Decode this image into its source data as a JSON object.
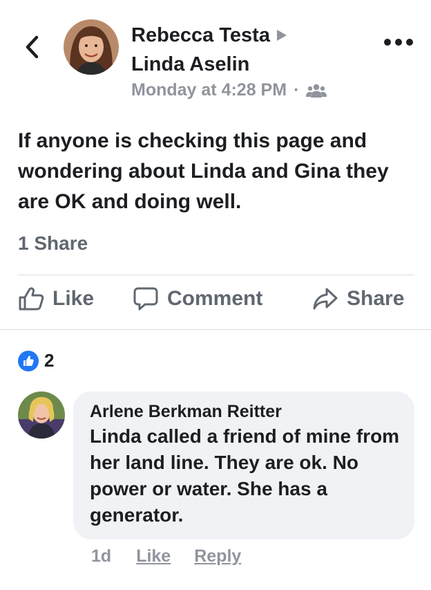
{
  "header": {
    "author": "Rebecca Testa",
    "target": "Linda Aselin",
    "timestamp": "Monday at 4:28 PM",
    "separator": "·",
    "privacy_icon": "group-icon"
  },
  "post": {
    "text": "If anyone is checking this page and wondering about Linda and Gina they are OK and doing well.",
    "share_count": "1 Share"
  },
  "actions": {
    "like": "Like",
    "comment": "Comment",
    "share": "Share"
  },
  "reactions": {
    "count": "2"
  },
  "comment": {
    "author": "Arlene Berkman Reitter",
    "text": "Linda called a friend of mine from her land line. They are ok. No power or water. She has a generator.",
    "time": "1d",
    "like": "Like",
    "reply": "Reply"
  },
  "colors": {
    "text": "#1c1e21",
    "secondary": "#606770",
    "muted": "#90949c",
    "like_blue": "#2078f4",
    "bubble": "#f0f2f5"
  }
}
